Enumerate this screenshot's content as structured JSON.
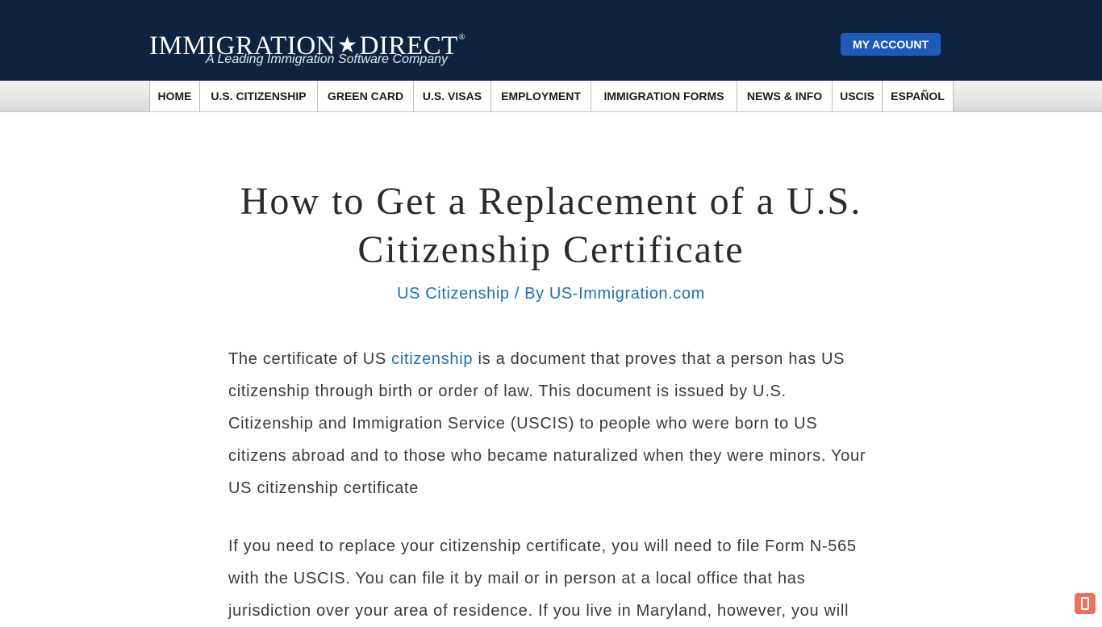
{
  "header": {
    "logo_main_left": "IMMIGRATION",
    "logo_star": "★",
    "logo_main_right": "DIRECT",
    "logo_reg": "®",
    "logo_tagline": "A Leading Immigration Software Company",
    "account_button": "MY ACCOUNT",
    "bg_color": "#0d2340",
    "button_color": "#1e5bb8"
  },
  "nav": {
    "items": [
      {
        "label": "HOME"
      },
      {
        "label": "U.S. CITIZENSHIP"
      },
      {
        "label": "GREEN CARD"
      },
      {
        "label": "U.S. VISAS"
      },
      {
        "label": "EMPLOYMENT"
      },
      {
        "label": "IMMIGRATION FORMS"
      },
      {
        "label": "NEWS & INFO"
      },
      {
        "label": "USCIS"
      },
      {
        "label": "ESPAÑOL"
      }
    ]
  },
  "article": {
    "title": "How to Get a Replacement of a U.S. Citizenship Certificate",
    "meta_category": "US Citizenship",
    "meta_separator": " / By ",
    "meta_author": "US-Immigration.com",
    "p1_before": "The certificate of US ",
    "p1_link": "citizenship",
    "p1_after": " is a document that proves that a person has US citizenship through birth or order of law. This document is issued by U.S. Citizenship and Immigration Service (USCIS) to people who were born to US citizens abroad and to those who became naturalized when they were minors. Your US citizenship certificate",
    "p2": "If you need to replace your citizenship certificate, you will need to file Form N-565 with the USCIS. You can file it by mail or in person at a local office that has jurisdiction over your area of residence. If you live in Maryland, however, you will",
    "link_color": "#1f6fb2"
  },
  "widget": {
    "icon": "mobile-icon",
    "color": "#f07060"
  }
}
